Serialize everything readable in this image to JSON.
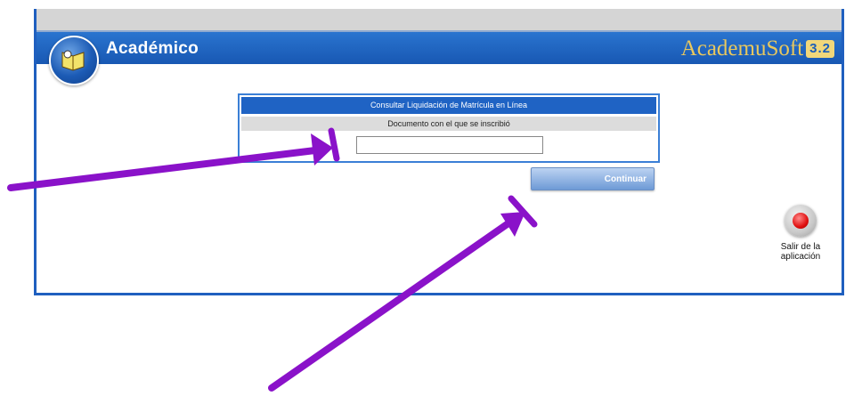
{
  "header": {
    "module_title": "Académico",
    "brand_name": "AcademuSoft",
    "brand_version": "3.2"
  },
  "form": {
    "title": "Consultar Liquidación de Matrícula en Línea",
    "document_label": "Documento con el que se inscribió",
    "document_value": "",
    "document_placeholder": "",
    "continue_label": "Continuar"
  },
  "exit": {
    "label_line1": "Salir de la",
    "label_line2": "aplicación"
  },
  "colors": {
    "frame_blue": "#1f5fbf",
    "brand_gold": "#e9c85d",
    "annotation_purple": "#8a12c9"
  },
  "icons": {
    "module_badge": "book-icon",
    "exit": "exit-icon",
    "annotation_1": "arrow-annotation",
    "annotation_2": "arrow-annotation"
  }
}
